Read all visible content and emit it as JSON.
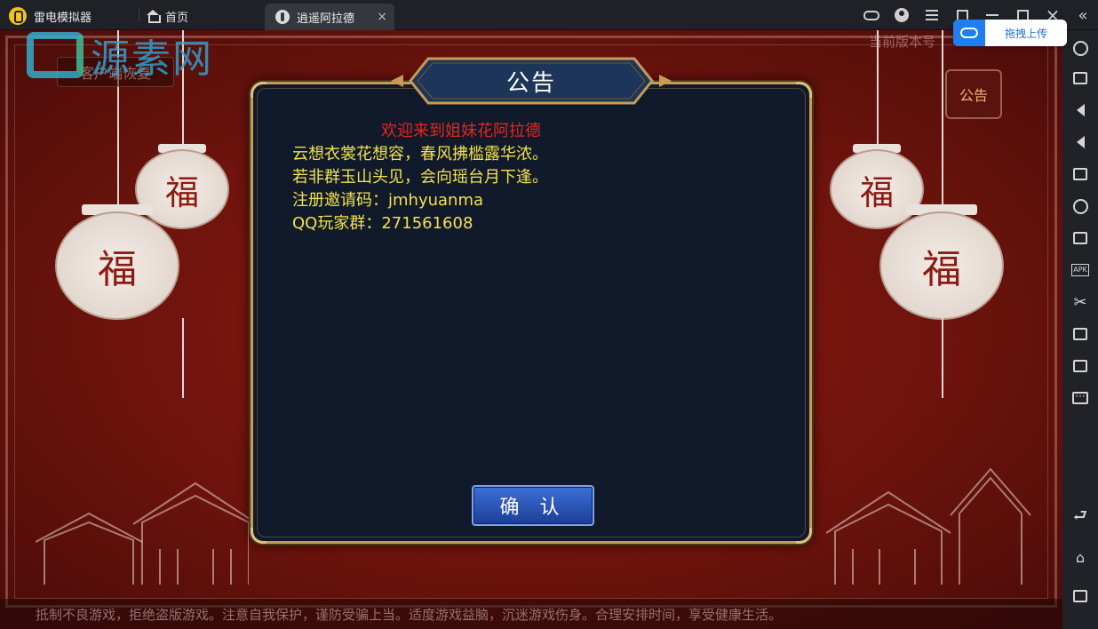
{
  "titlebar": {
    "app_name": "雷电模拟器",
    "home_tab": "首页",
    "game_tab": "逍遥阿拉德",
    "close_glyph": "×",
    "upload_label": "拖拽上传"
  },
  "game": {
    "watermark_text": "源素网",
    "ghost_button": "客户端恢复",
    "version_label": "当前版本号",
    "notice_badge": "公告",
    "lantern_char": "福",
    "ticker": "抵制不良游戏，拒绝盗版游戏。注意自我保护，谨防受骗上当。适度游戏益脑，沉迷游戏伤身。合理安排时间，享受健康生活。"
  },
  "dialog": {
    "title": "公告",
    "heading": "欢迎来到姐妹花阿拉德",
    "lines": [
      "云想衣裳花想容，春风拂槛露华浓。",
      "若非群玉山头见，会向瑶台月下逢。",
      "注册邀请码：jmhyuanma",
      "QQ玩家群：271561608"
    ],
    "confirm": "确 认"
  },
  "sidebar": {
    "apk_label": "APK",
    "more_glyph": "···",
    "tools": [
      "settings-icon",
      "keyboard-icon",
      "volume-down-icon",
      "volume-up-icon",
      "fullscreen-icon",
      "rotate-icon",
      "add-window-icon",
      "apk-icon",
      "scissors-icon",
      "video-record-icon",
      "sync-icon",
      "more-icon",
      "back-icon",
      "home-icon",
      "recent-apps-icon"
    ]
  },
  "colors": {
    "heading_red": "#e8261c",
    "text_yellow": "#f4e14a",
    "dialog_bg": "#101a2b",
    "gold_border": "#c79b57",
    "button_blue": "#2a56b8",
    "game_red": "#8e1a12"
  }
}
